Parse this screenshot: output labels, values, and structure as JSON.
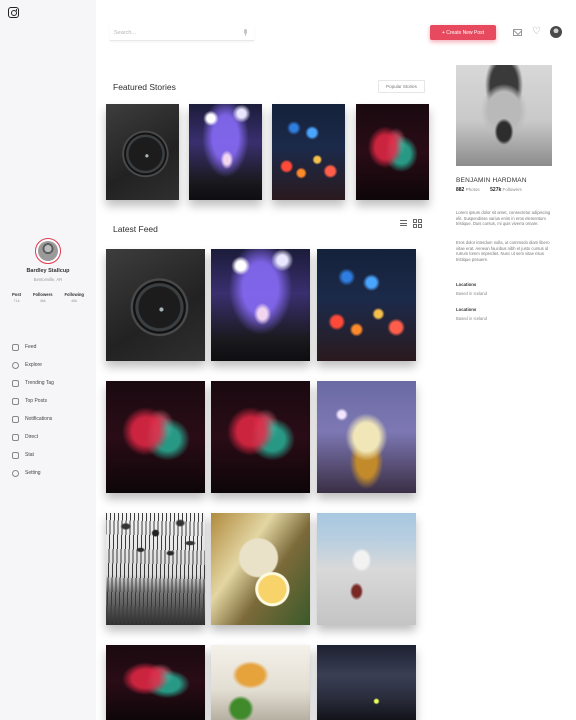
{
  "search": {
    "placeholder": "Search..."
  },
  "header": {
    "create_label": "+ Create New Post"
  },
  "profile": {
    "name": "Bardley Stallcup",
    "location": "Bentonville, AR",
    "stats": [
      {
        "label": "Post",
        "value": "71k"
      },
      {
        "label": "Followers",
        "value": "46k"
      },
      {
        "label": "Following",
        "value": "48k"
      }
    ]
  },
  "nav": {
    "items": [
      {
        "label": "Feed",
        "icon": "home-icon"
      },
      {
        "label": "Explore",
        "icon": "compass-icon"
      },
      {
        "label": "Trending Tag",
        "icon": "hashtag-icon"
      },
      {
        "label": "Top Posts",
        "icon": "image-icon"
      },
      {
        "label": "Notifications",
        "icon": "bell-icon"
      },
      {
        "label": "Direct",
        "icon": "send-icon"
      },
      {
        "label": "Stat",
        "icon": "chart-icon"
      },
      {
        "label": "Setting",
        "icon": "gear-icon"
      }
    ]
  },
  "featured": {
    "title": "Featured Stories",
    "filter_label": "Popular Stories",
    "images": [
      "watch",
      "concert",
      "bokeh",
      "hands"
    ]
  },
  "latest": {
    "title": "Latest Feed",
    "images": [
      "watch",
      "concert",
      "bokeh",
      "hands",
      "hands",
      "portland",
      "birds",
      "food",
      "skate",
      "hands",
      "pizza",
      "night"
    ]
  },
  "right_panel": {
    "name": "BENJAMIN HARDMAN",
    "photos_count": "882",
    "photos_label": "Photos",
    "followers_count": "527k",
    "followers_label": "Followers",
    "bio_1": "Lorem ipsum dolor sit amet, consectetur adipiscing elit. Suspendisse varius enim in eros elementum tristique. Duis cursus, mi quis viverra ornare.",
    "bio_2": "Eros dolor interdum nulla, ut commodo diam libero vitae erat. Aenean faucibus nibh et justo cursus id rutrum lorem imperdiet. Nunc ut sem vitae risus tristique posuere.",
    "location_label_1": "Locations",
    "location_value_1": "Based in Iceland",
    "location_label_2": "Locations",
    "location_value_2": "Based in Iceland"
  },
  "colors": {
    "accent": "#e74a5e",
    "sidebar_bg": "#f6f6f8"
  }
}
